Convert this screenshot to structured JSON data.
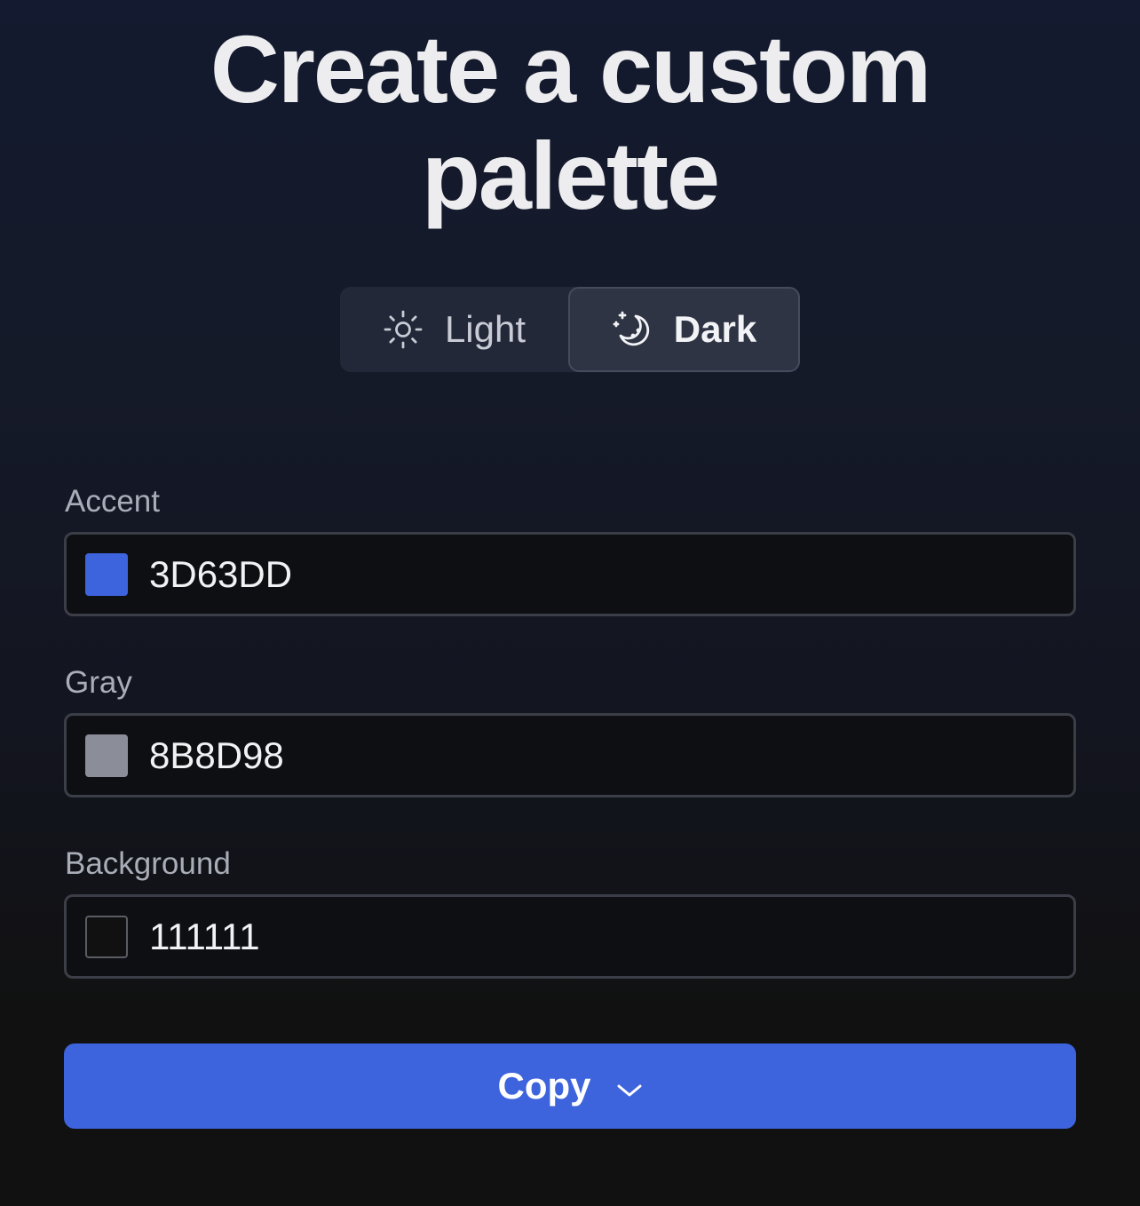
{
  "title": "Create a custom palette",
  "title_line1": "Create a custom",
  "title_line2": "palette",
  "appearance": {
    "options": [
      {
        "label": "Light",
        "icon": "sun-icon",
        "selected": false
      },
      {
        "label": "Dark",
        "icon": "moon-stars-icon",
        "selected": true
      }
    ]
  },
  "fields": {
    "accent": {
      "label": "Accent",
      "value": "3D63DD",
      "swatch": "#3D63DD"
    },
    "gray": {
      "label": "Gray",
      "value": "8B8D98",
      "swatch": "#8B8D98"
    },
    "background": {
      "label": "Background",
      "value": "111111",
      "swatch": "#111111"
    }
  },
  "copy_button": {
    "label": "Copy",
    "icon": "chevron-down-icon"
  },
  "colors": {
    "primary": "#3D63DD"
  }
}
